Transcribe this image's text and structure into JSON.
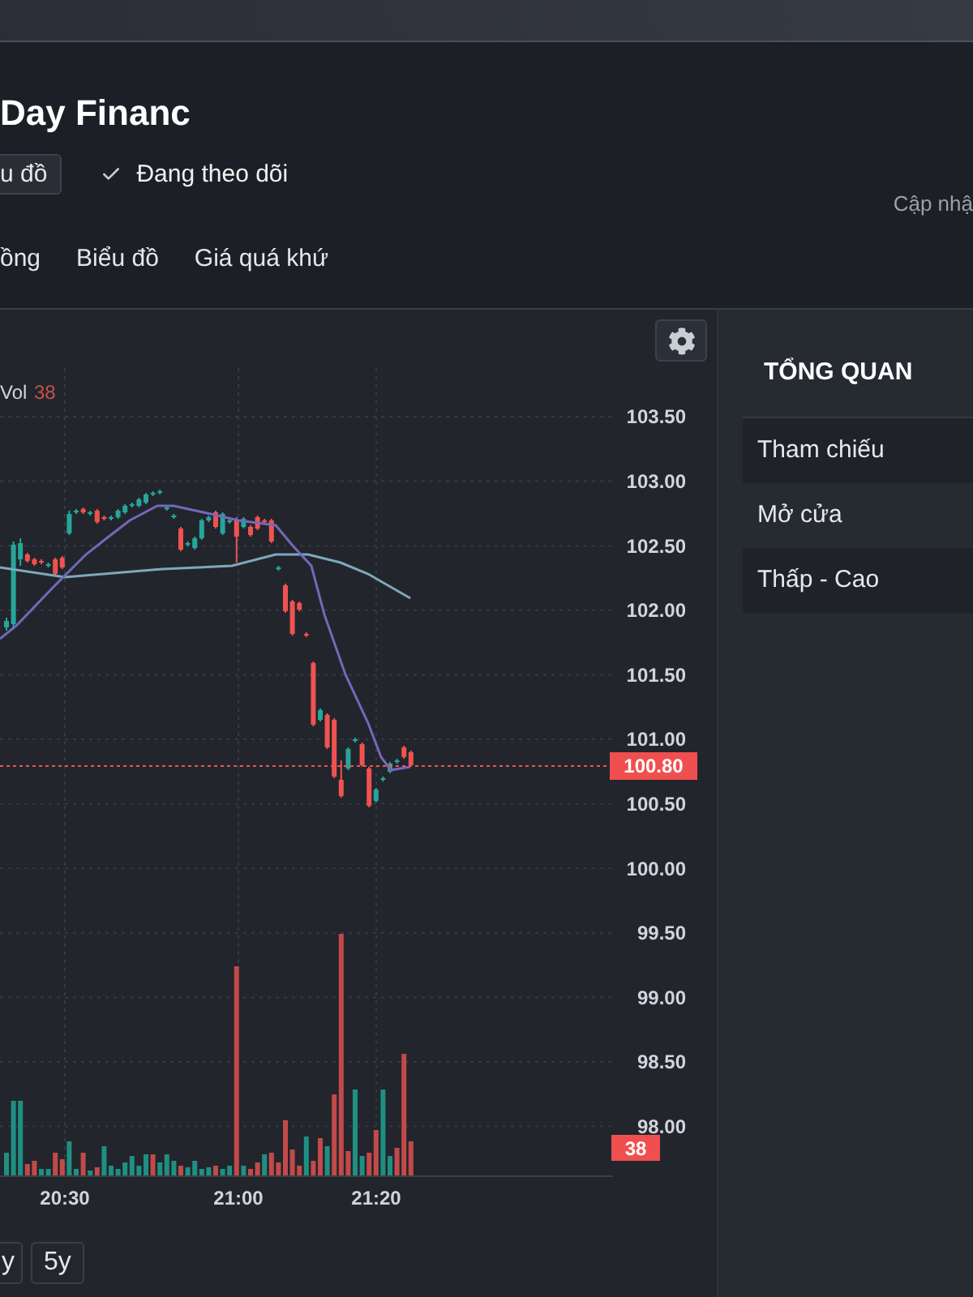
{
  "header": {
    "title": "Day Financ",
    "actions": [
      {
        "kind": "button",
        "label": "u đồ"
      },
      {
        "kind": "toggle",
        "label": "Đang theo dõi",
        "checked": true
      }
    ],
    "update_note": "Cập nhậ"
  },
  "tabs": [
    {
      "label": "ồng",
      "selected": false
    },
    {
      "label": "Biểu đồ",
      "selected": false
    },
    {
      "label": "Giá quá khứ",
      "selected": false
    }
  ],
  "chart": {
    "legend": {
      "label": "Vol",
      "value": "38"
    },
    "price_ticks": [
      "103.50",
      "103.00",
      "102.50",
      "102.00",
      "101.50",
      "101.00",
      "100.50",
      "100.00",
      "99.50",
      "99.00",
      "98.50",
      "98.00"
    ],
    "time_ticks": [
      "20:30",
      "21:00",
      "21:20"
    ],
    "last_price": "100.80",
    "last_volume": "38"
  },
  "ranges": [
    {
      "label": "y",
      "selected": false
    },
    {
      "label": "5y",
      "selected": false
    }
  ],
  "overview": {
    "title": "TỔNG QUAN",
    "rows": [
      "Tham chiếu",
      "Mở cửa",
      "Thấp - Cao"
    ]
  }
}
